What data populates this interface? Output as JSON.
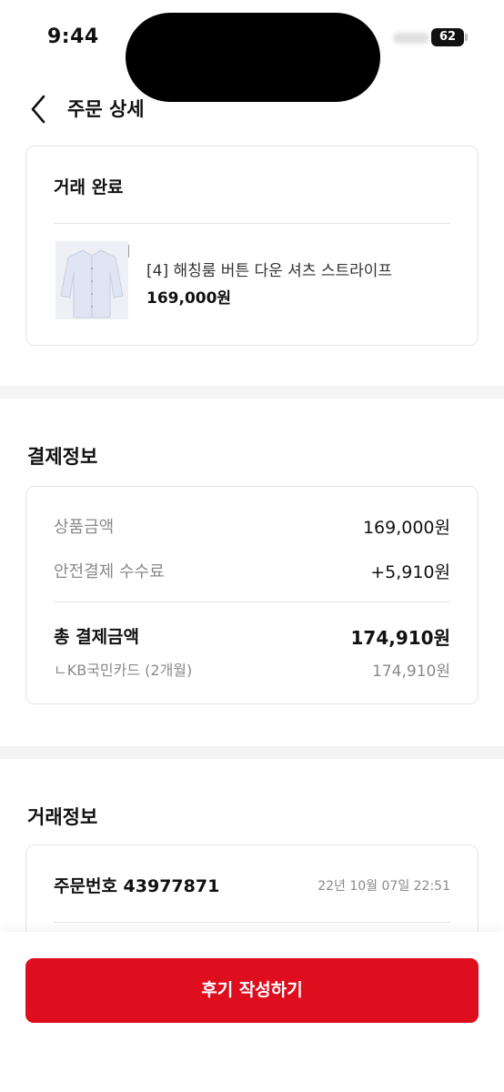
{
  "status_bar": {
    "time": "9:44",
    "battery": "62"
  },
  "header": {
    "title": "주문 상세",
    "back_icon": "chevron-left-icon"
  },
  "order_status": {
    "label": "거래 완료",
    "product": {
      "name": "[4] 해칭룸 버튼 다운 셔츠 스트라이프",
      "price": "169,000원"
    }
  },
  "payment": {
    "section_title": "결제정보",
    "rows": [
      {
        "label": "상품금액",
        "value": "169,000원"
      },
      {
        "label": "안전결제 수수료",
        "value": "+5,910원"
      }
    ],
    "total": {
      "label": "총 결제금액",
      "value": "174,910원"
    },
    "method": {
      "label": "ㄴKB국민카드 (2개월)",
      "value": "174,910원"
    }
  },
  "trade": {
    "section_title": "거래정보",
    "order_number": "주문번호 43977871",
    "order_date": "22년 10월 07일 22:51"
  },
  "actions": {
    "review_label": "후기 작성하기"
  },
  "colors": {
    "accent": "#df0e1f",
    "border": "#e4e4e4",
    "muted_text": "#8a8a8a"
  }
}
